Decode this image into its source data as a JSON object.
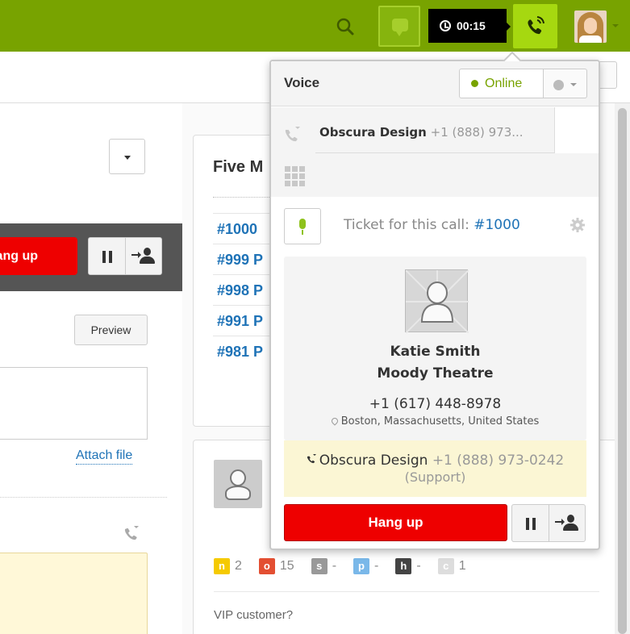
{
  "topbar": {
    "timer": "00:15",
    "colors": {
      "bar": "#78a300",
      "active": "#a6d810"
    },
    "icons": [
      "search-icon",
      "chat-icon",
      "clock-icon",
      "phone-icon",
      "avatar"
    ]
  },
  "left": {
    "hangup_label": "Hang up",
    "preview_label": "Preview",
    "attach_label": "Attach file"
  },
  "recent": {
    "title": "Five M",
    "tickets": [
      "#1000",
      "#999 P",
      "#998 P",
      "#991 P",
      "#981 P"
    ]
  },
  "user_card": {
    "badges": [
      {
        "letter": "n",
        "value": "2",
        "color": "#f5ca00"
      },
      {
        "letter": "o",
        "value": "15",
        "color": "#e34f32"
      },
      {
        "letter": "s",
        "value": "-",
        "color": "#999999"
      },
      {
        "letter": "p",
        "value": "-",
        "color": "#7ab8e9"
      },
      {
        "letter": "h",
        "value": "-",
        "color": "#444444"
      },
      {
        "letter": "c",
        "value": "1",
        "color": "#dddddd"
      }
    ],
    "vip_label": "VIP customer?"
  },
  "voice": {
    "title": "Voice",
    "status": "Online",
    "active_call_name": "Obscura Design",
    "active_call_phone": "+1 (888) 973...",
    "ticket_prefix": "Ticket for this call:",
    "ticket_link": "#1000",
    "caller": {
      "name": "Katie Smith",
      "org": "Moody Theatre",
      "phone": "+1 (617) 448-8978",
      "location": "Boston, Massachusetts, United States"
    },
    "via": {
      "name": "Obscura Design",
      "phone": "+1 (888) 973-0242",
      "line": "(Support)"
    },
    "hangup_label": "Hang up",
    "colors": {
      "hangup": "#ee0000",
      "online": "#78a300",
      "link": "#1f73b7"
    }
  }
}
